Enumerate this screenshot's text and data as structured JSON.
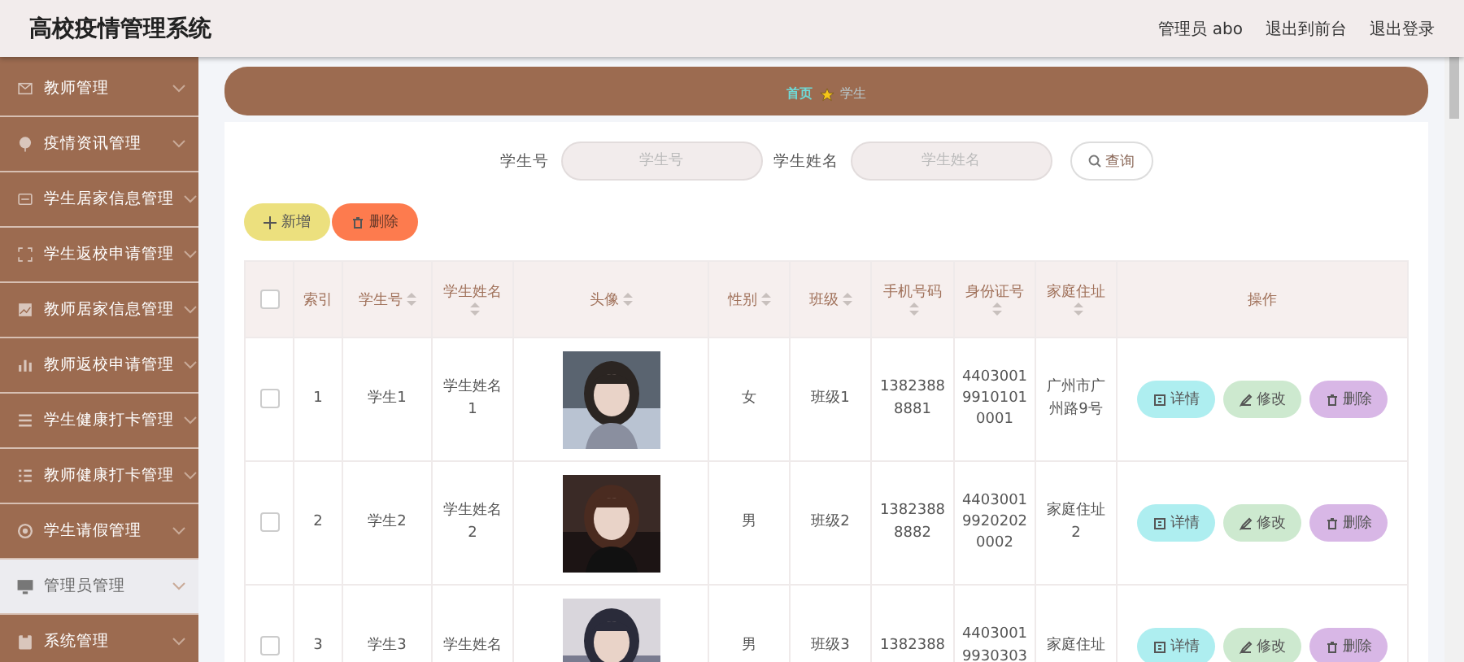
{
  "header": {
    "title": "高校疫情管理系统",
    "user": "管理员 abo",
    "links": [
      "退出到前台",
      "退出登录"
    ]
  },
  "sidebar": {
    "items": [
      {
        "label": "教师管理",
        "selected": false
      },
      {
        "label": "疫情资讯管理",
        "selected": false
      },
      {
        "label": "学生居家信息管理",
        "selected": false
      },
      {
        "label": "学生返校申请管理",
        "selected": false
      },
      {
        "label": "教师居家信息管理",
        "selected": false
      },
      {
        "label": "教师返校申请管理",
        "selected": false
      },
      {
        "label": "学生健康打卡管理",
        "selected": false
      },
      {
        "label": "教师健康打卡管理",
        "selected": false
      },
      {
        "label": "学生请假管理",
        "selected": false
      },
      {
        "label": "管理员管理",
        "selected": true
      },
      {
        "label": "系统管理",
        "selected": false
      }
    ]
  },
  "breadcrumb": {
    "home": "首页",
    "current": "学生"
  },
  "search": {
    "fields": [
      {
        "label": "学生号",
        "placeholder": "学生号"
      },
      {
        "label": "学生姓名",
        "placeholder": "学生姓名"
      }
    ],
    "button": "查询"
  },
  "toolbar": {
    "add": "新增",
    "delete": "删除"
  },
  "table": {
    "all_checked": false,
    "columns": [
      {
        "label": "索引",
        "sortable": false
      },
      {
        "label": "学生号",
        "sortable": true
      },
      {
        "label": "学生姓名",
        "sortable": true
      },
      {
        "label": "头像",
        "sortable": true
      },
      {
        "label": "性别",
        "sortable": true
      },
      {
        "label": "班级",
        "sortable": true
      },
      {
        "label": "手机号码",
        "sortable": true
      },
      {
        "label": "身份证号",
        "sortable": true
      },
      {
        "label": "家庭住址",
        "sortable": true
      },
      {
        "label": "操作",
        "sortable": false
      }
    ],
    "rows": [
      {
        "checked": false,
        "index": "1",
        "student_no": "学生1",
        "name": "学生姓名1",
        "gender": "女",
        "class": "班级1",
        "phone": "13823888881",
        "id_no": "440300199101010001",
        "address": "广州市广州路9号",
        "actions": [
          "详情",
          "修改",
          "删除"
        ]
      },
      {
        "checked": false,
        "index": "2",
        "student_no": "学生2",
        "name": "学生姓名2",
        "gender": "男",
        "class": "班级2",
        "phone": "13823888882",
        "id_no": "440300199202020002",
        "address": "家庭住址2",
        "actions": [
          "详情",
          "修改",
          "删除"
        ]
      },
      {
        "checked": false,
        "index": "3",
        "student_no": "学生3",
        "name": "学生姓名",
        "gender": "男",
        "class": "班级3",
        "phone": "1382388",
        "id_no": "44030019930303",
        "address": "家庭住址",
        "actions": [
          "详情",
          "修改",
          "删除"
        ]
      }
    ]
  }
}
